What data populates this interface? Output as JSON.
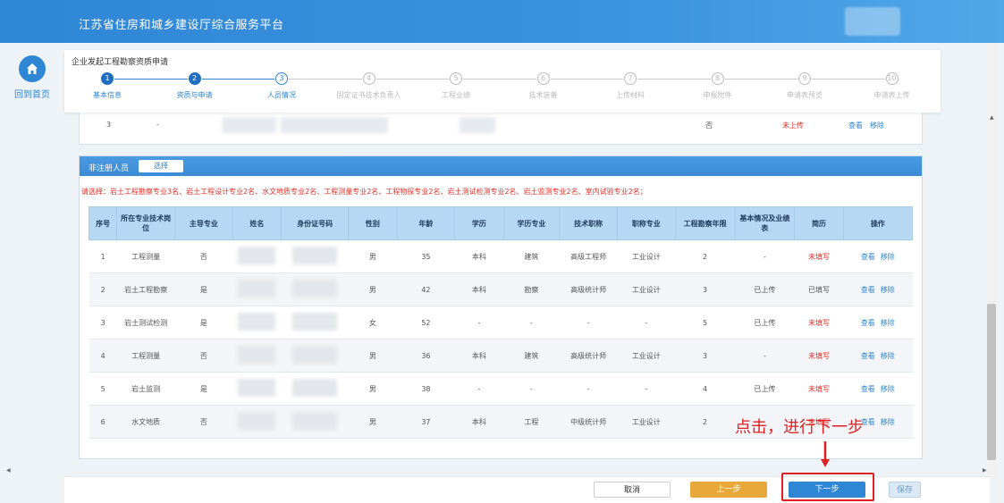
{
  "header": {
    "title": "江苏省住房和城乡建设厅综合服务平台"
  },
  "home": {
    "label": "回到首页"
  },
  "stepbar": {
    "title": "企业发起工程勘察资质申请",
    "steps": [
      {
        "num": "1",
        "label": "基本信息",
        "state": "done"
      },
      {
        "num": "2",
        "label": "资质与申请",
        "state": "done"
      },
      {
        "num": "3",
        "label": "人员情况",
        "state": "active"
      },
      {
        "num": "4",
        "label": "固定证书技术负责人",
        "state": "todo"
      },
      {
        "num": "5",
        "label": "工程业绩",
        "state": "todo"
      },
      {
        "num": "6",
        "label": "技术装备",
        "state": "todo"
      },
      {
        "num": "7",
        "label": "上传材料",
        "state": "todo"
      },
      {
        "num": "8",
        "label": "申报附件",
        "state": "todo"
      },
      {
        "num": "9",
        "label": "申请表预览",
        "state": "todo"
      },
      {
        "num": "10",
        "label": "申请表上传",
        "state": "todo"
      }
    ]
  },
  "prev_row": {
    "index": "3",
    "dash": "-",
    "flag": "否",
    "status": "未上传",
    "view": "查看",
    "remove": "移除"
  },
  "panel": {
    "title": "非注册人员",
    "select_label": "选择",
    "notice": "请选择：岩土工程勘察专业3名、岩土工程设计专业2名、水文地质专业2名、工程测量专业2名、工程物探专业2名、岩土测试检测专业2名、岩土监测专业2名、室内试验专业2名；",
    "columns": [
      "序号",
      "所在专业技术岗位",
      "主导专业",
      "姓名",
      "身份证号码",
      "性别",
      "年龄",
      "学历",
      "学历专业",
      "技术职称",
      "职称专业",
      "工程勘察年限",
      "基本情况及业绩表",
      "简历",
      "操作"
    ],
    "rows": [
      {
        "no": "1",
        "post": "工程测量",
        "main": "否",
        "gender": "男",
        "age": "35",
        "edu": "本科",
        "major": "建筑",
        "title": "高级工程师",
        "title_major": "工业设计",
        "years": "2",
        "perf": "-",
        "resume": "未填写",
        "resume_red": true
      },
      {
        "no": "2",
        "post": "岩土工程勘察",
        "main": "是",
        "gender": "男",
        "age": "42",
        "edu": "本科",
        "major": "勘察",
        "title": "高级统计师",
        "title_major": "工业设计",
        "years": "3",
        "perf": "已上传",
        "resume": "已填写",
        "resume_red": false
      },
      {
        "no": "3",
        "post": "岩土测试检测",
        "main": "是",
        "gender": "女",
        "age": "52",
        "edu": "-",
        "major": "-",
        "title": "-",
        "title_major": "-",
        "years": "5",
        "perf": "已上传",
        "resume": "未填写",
        "resume_red": true
      },
      {
        "no": "4",
        "post": "工程测量",
        "main": "否",
        "gender": "男",
        "age": "36",
        "edu": "本科",
        "major": "建筑",
        "title": "高级统计师",
        "title_major": "工业设计",
        "years": "3",
        "perf": "-",
        "resume": "未填写",
        "resume_red": true
      },
      {
        "no": "5",
        "post": "岩土监测",
        "main": "是",
        "gender": "男",
        "age": "38",
        "edu": "-",
        "major": "-",
        "title": "-",
        "title_major": "-",
        "years": "4",
        "perf": "已上传",
        "resume": "未填写",
        "resume_red": true
      },
      {
        "no": "6",
        "post": "水文地质",
        "main": "否",
        "gender": "男",
        "age": "37",
        "edu": "本科",
        "major": "工程",
        "title": "中级统计师",
        "title_major": "工业设计",
        "years": "2",
        "perf": "",
        "resume": "未填写",
        "resume_red": true
      }
    ],
    "view": "查看",
    "remove": "移除"
  },
  "footer": {
    "cancel": "取消",
    "prev": "上一步",
    "next": "下一步",
    "save": "保存"
  },
  "annotation": {
    "text": "点击，进行下一步",
    "color": "#e02020"
  },
  "colors": {
    "primary": "#2e86d4",
    "header": "#3b93de",
    "warning": "#e9a93a",
    "danger": "#e0312a"
  }
}
